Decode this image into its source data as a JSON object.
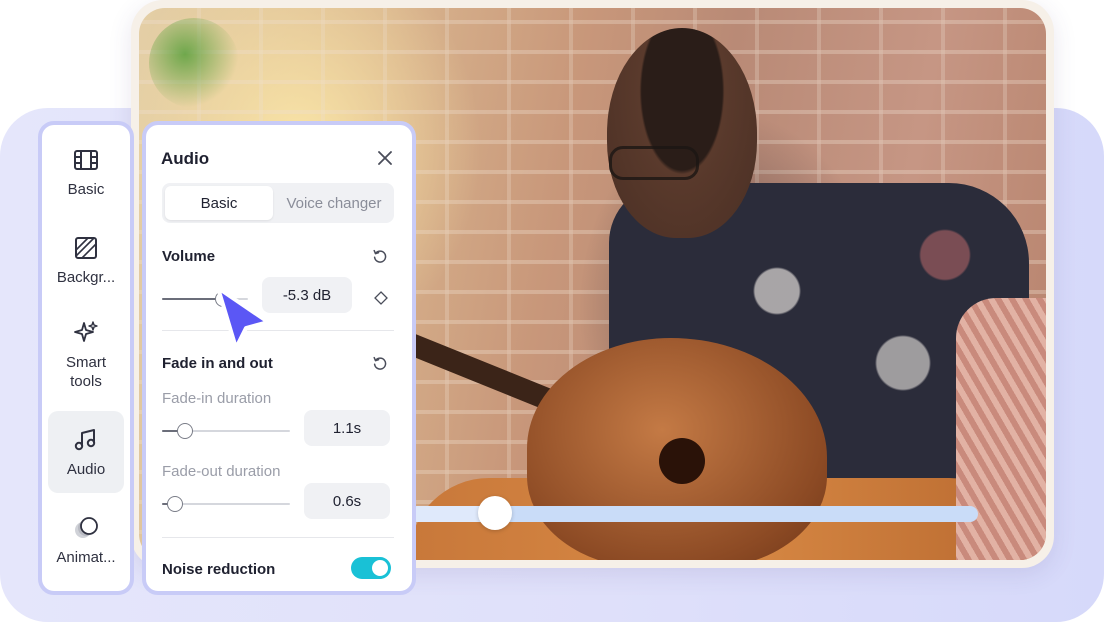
{
  "sidebar": {
    "items": [
      {
        "label": "Basic",
        "icon": "film-icon",
        "active": false
      },
      {
        "label": "Backgr...",
        "icon": "background-icon",
        "active": false
      },
      {
        "label": "Smart\ntools",
        "icon": "sparkle-icon",
        "active": false
      },
      {
        "label": "Audio",
        "icon": "music-note-icon",
        "active": true
      },
      {
        "label": "Animat...",
        "icon": "animation-icon",
        "active": false
      }
    ]
  },
  "panel": {
    "title": "Audio",
    "tabs": [
      {
        "label": "Basic",
        "active": true
      },
      {
        "label": "Voice changer",
        "active": false
      }
    ],
    "volume": {
      "title": "Volume",
      "value_text": "-5.3 dB",
      "slider_level": 0.71
    },
    "fade": {
      "title": "Fade in and out",
      "fade_in": {
        "label": "Fade-in duration",
        "value_text": "1.1s",
        "slider_level": 0.18
      },
      "fade_out": {
        "label": "Fade-out duration",
        "value_text": "0.6s",
        "slider_level": 0.1
      }
    },
    "noise": {
      "title": "Noise reduction",
      "enabled": true
    }
  },
  "player": {
    "progress": 0.15
  },
  "colors": {
    "accent_cursor": "#5b57f5",
    "toggle_on": "#19c1d6",
    "panel_border": "#c8cbf7"
  }
}
